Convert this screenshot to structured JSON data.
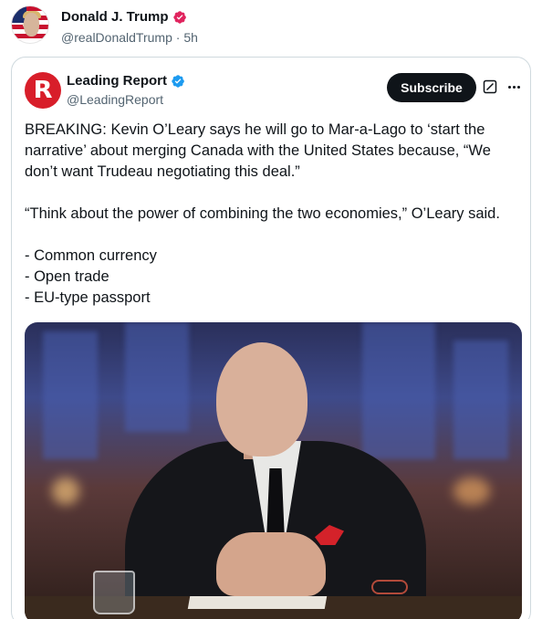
{
  "outer_post": {
    "author_name": "Donald J. Trump",
    "handle": "@realDonaldTrump",
    "separator": "·",
    "time": "5h",
    "badge_icon": "verified-badge-icon",
    "badge_color": "#e0245e"
  },
  "quoted_post": {
    "author_name": "Leading Report",
    "handle": "@LeadingReport",
    "avatar_letter": "R",
    "avatar_color": "#d81e2a",
    "badge_icon": "verified-badge-icon",
    "badge_color": "#1d9bf0",
    "subscribe_label": "Subscribe",
    "grok_icon": "grok-icon",
    "more_icon": "more-icon",
    "text": {
      "line1": "BREAKING: Kevin O’Leary says he will go to Mar-a-Lago to ‘start the narrative’ about merging Canada with the United States because, “We don’t want Trudeau negotiating this deal.”",
      "line2": "“Think about the power of combining the two economies,” O’Leary said.",
      "bullet1": "- Common currency",
      "bullet2": "- Open trade",
      "bullet3": "- EU-type passport"
    },
    "media_description_icon": "photo-image"
  }
}
